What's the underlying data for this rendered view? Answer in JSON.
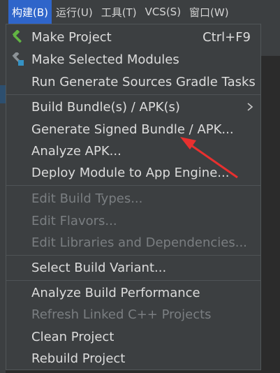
{
  "menubar": {
    "items": [
      {
        "label": "构建(B)"
      },
      {
        "label": "运行(U)"
      },
      {
        "label": "工具(T)"
      },
      {
        "label": "VCS(S)"
      },
      {
        "label": "窗口(W)"
      }
    ]
  },
  "menu": {
    "items": [
      {
        "label": "Make Project",
        "shortcut": "Ctrl+F9",
        "icon": "hammer-icon",
        "enabled": true
      },
      {
        "label": "Make Selected Modules",
        "icon": "hammer-modules-icon",
        "enabled": true
      },
      {
        "label": "Run Generate Sources Gradle Tasks",
        "enabled": true
      },
      {
        "label": "Build Bundle(s) / APK(s)",
        "submenu": true,
        "enabled": true
      },
      {
        "label": "Generate Signed Bundle / APK...",
        "enabled": true
      },
      {
        "label": "Analyze APK...",
        "enabled": true
      },
      {
        "label": "Deploy Module to App Engine...",
        "enabled": true
      },
      {
        "label": "Edit Build Types...",
        "enabled": false
      },
      {
        "label": "Edit Flavors...",
        "enabled": false
      },
      {
        "label": "Edit Libraries and Dependencies...",
        "enabled": false
      },
      {
        "label": "Select Build Variant...",
        "enabled": true
      },
      {
        "label": "Analyze Build Performance",
        "enabled": true
      },
      {
        "label": "Refresh Linked C++ Projects",
        "enabled": false
      },
      {
        "label": "Clean Project",
        "enabled": true
      },
      {
        "label": "Rebuild Project",
        "enabled": true
      }
    ]
  },
  "colors": {
    "menubar_bg": "#3c3f41",
    "active_menu_bg": "#2f65ca",
    "text": "#dcdcdc",
    "disabled_text": "#7a7e81",
    "annotation_arrow": "#e8302f"
  }
}
